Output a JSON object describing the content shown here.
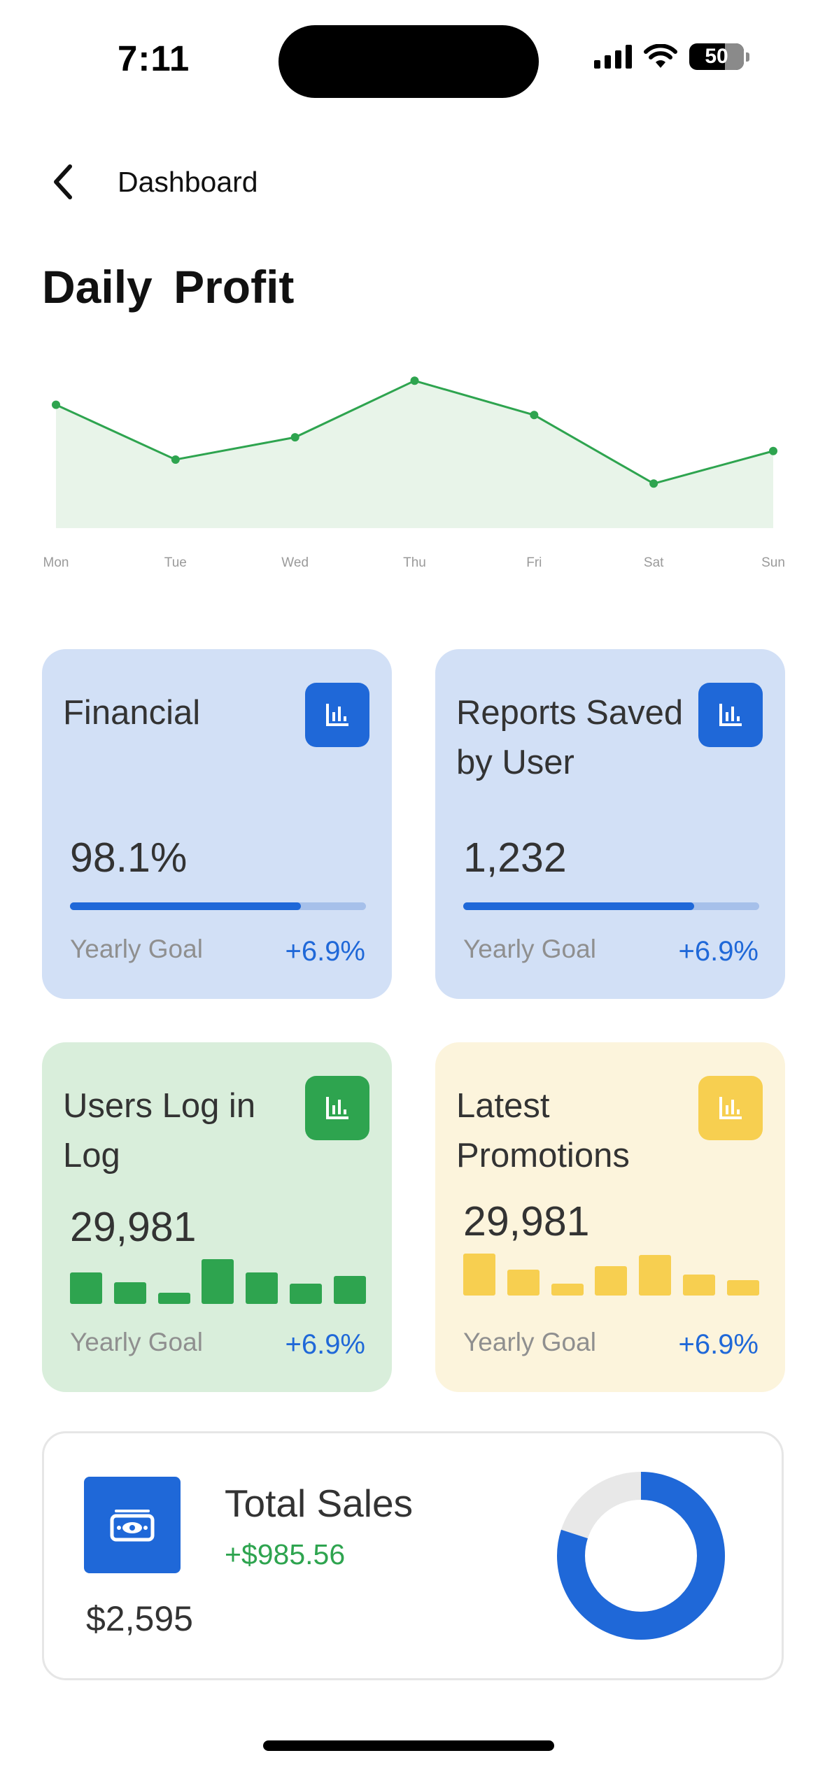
{
  "status": {
    "time": "7:11",
    "battery": "50",
    "battery_level": 0.5
  },
  "nav": {
    "back_icon": "chevron-left-icon",
    "title": "Dashboard"
  },
  "page_title": "Daily  Profit",
  "chart_data": {
    "type": "area",
    "categories": [
      "Mon",
      "Tue",
      "Wed",
      "Thu",
      "Fri",
      "Sat",
      "Sun"
    ],
    "values": [
      72,
      40,
      53,
      86,
      66,
      26,
      45
    ],
    "ylim": [
      0,
      100
    ],
    "colors": {
      "line": "#2ea44f",
      "fill": "#e8f4e9",
      "point": "#2ea44f"
    },
    "grid": false
  },
  "cards": {
    "financial": {
      "title": "Financial",
      "value": "98.1%",
      "progress": 0.78,
      "goal_label": "Yearly Goal",
      "change": "+6.9%",
      "icon": "bar-chart-icon"
    },
    "reports": {
      "title": "Reports Saved by User",
      "value": "1,232",
      "progress": 0.78,
      "goal_label": "Yearly Goal",
      "change": "+6.9%",
      "icon": "bar-chart-icon"
    },
    "users": {
      "title": "Users Log in Log",
      "value": "29,981",
      "bars": [
        0.7,
        0.48,
        0.25,
        1.0,
        0.7,
        0.45,
        0.62
      ],
      "goal_label": "Yearly Goal",
      "change": "+6.9%",
      "icon": "bar-chart-icon"
    },
    "promotions": {
      "title": "Latest Promotions",
      "value": "29,981",
      "bars": [
        1.0,
        0.62,
        0.28,
        0.7,
        0.97,
        0.5,
        0.37
      ],
      "goal_label": "Yearly Goal",
      "change": "+6.9%",
      "icon": "bar-chart-icon"
    }
  },
  "colors": {
    "blue": "#1f68d8",
    "blue_card": "#d2e0f6",
    "blue_track": "#a6c0ea",
    "green": "#2ea44f",
    "green_card": "#d9eedb",
    "yellow": "#f7cf50",
    "yellow_card": "#fcf4dc"
  },
  "sales": {
    "title": "Total Sales",
    "change": "+$985.56",
    "amount": "$2,595",
    "icon": "money-bill-icon",
    "donut_fraction": 0.8
  }
}
